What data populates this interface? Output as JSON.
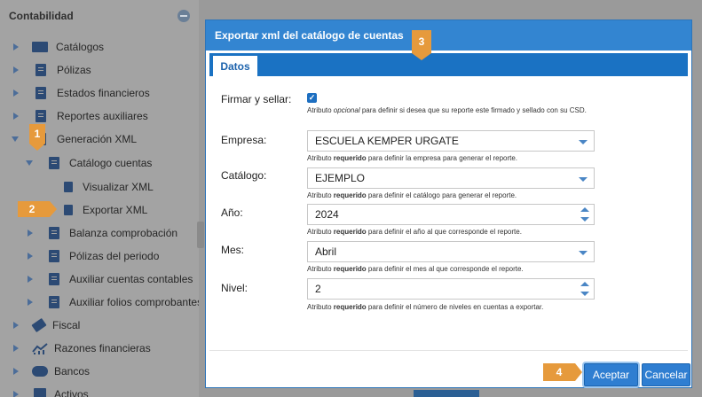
{
  "sidebar": {
    "title": "Contabilidad",
    "items": [
      {
        "label": "Catálogos",
        "icon": "folder-icon"
      },
      {
        "label": "Pólizas",
        "icon": "document-icon"
      },
      {
        "label": "Estados financieros",
        "icon": "document-icon"
      },
      {
        "label": "Reportes auxiliares",
        "icon": "document-icon"
      },
      {
        "label": "Generación XML",
        "icon": "document-icon"
      },
      {
        "label": "Catálogo cuentas",
        "icon": "document-icon"
      },
      {
        "label": "Visualizar XML",
        "icon": "document-icon"
      },
      {
        "label": "Exportar XML",
        "icon": "document-icon"
      },
      {
        "label": "Balanza comprobación",
        "icon": "document-icon"
      },
      {
        "label": "Pólizas del periodo",
        "icon": "document-icon"
      },
      {
        "label": "Auxiliar cuentas contables",
        "icon": "document-icon"
      },
      {
        "label": "Auxiliar folios comprobantes",
        "icon": "document-icon"
      },
      {
        "label": "Fiscal",
        "icon": "gavel-icon"
      },
      {
        "label": "Razones financieras",
        "icon": "chart-icon"
      },
      {
        "label": "Bancos",
        "icon": "piggy-bank-icon"
      },
      {
        "label": "Activos",
        "icon": "building-icon"
      }
    ]
  },
  "badges": {
    "one": "1",
    "two": "2",
    "three": "3",
    "four": "4"
  },
  "modal": {
    "title": "Exportar xml del catálogo de cuentas",
    "tab": "Datos",
    "firmar": {
      "label": "Firmar y sellar:",
      "checked": true,
      "help_pre": "Atributo ",
      "help_em": "opcional",
      "help_post": " para definir si desea que su reporte este firmado y sellado con su CSD."
    },
    "empresa": {
      "label": "Empresa:",
      "value": "ESCUELA KEMPER URGATE",
      "help_pre": "Atributo ",
      "help_b": "requerido",
      "help_post": " para definir la empresa para generar el reporte."
    },
    "catalogo": {
      "label": "Catálogo:",
      "value": "EJEMPLO",
      "help_pre": "Atributo ",
      "help_b": "requerido",
      "help_post": " para definir el catálogo para generar el reporte."
    },
    "anio": {
      "label": "Año:",
      "value": "2024",
      "help_pre": "Atributo ",
      "help_b": "requerido",
      "help_post": " para definir el año al que corresponde el reporte."
    },
    "mes": {
      "label": "Mes:",
      "value": "Abril",
      "help_pre": "Atributo ",
      "help_b": "requerido",
      "help_post": " para definir el mes al que corresponde el reporte."
    },
    "nivel": {
      "label": "Nivel:",
      "value": "2",
      "help_pre": "Atributo ",
      "help_b": "requerido",
      "help_post": " para definir el número de niveles en cuentas a exportar."
    },
    "accept_label": "Aceptar",
    "cancel_label": "Cancelar"
  },
  "colors": {
    "accent": "#3385d1",
    "badge": "#e69a3c"
  }
}
